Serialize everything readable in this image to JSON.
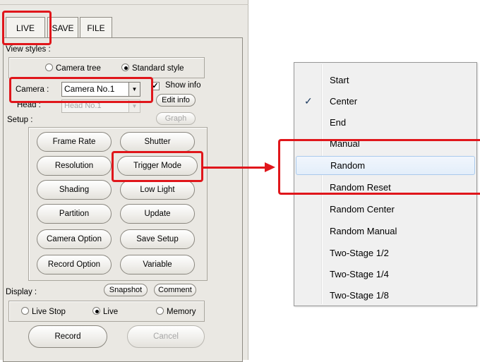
{
  "tabs": [
    {
      "label": "LIVE",
      "active": true
    },
    {
      "label": "SAVE",
      "active": false
    },
    {
      "label": "FILE",
      "active": false
    }
  ],
  "view_styles": {
    "label": "View styles :",
    "options": [
      {
        "label": "Camera tree",
        "selected": false
      },
      {
        "label": "Standard style",
        "selected": true
      }
    ]
  },
  "camera": {
    "label": "Camera :",
    "value": "Camera No.1",
    "show_info_label": "Show info",
    "show_info_checked": true,
    "edit_info_label": "Edit info"
  },
  "head": {
    "label": "Head :",
    "value": "Head No.1",
    "graph_label": "Graph"
  },
  "setup": {
    "label": "Setup :",
    "buttons": [
      "Frame Rate",
      "Shutter",
      "Resolution",
      "Trigger Mode",
      "Shading",
      "Low Light",
      "Partition",
      "Update",
      "Camera Option",
      "Save Setup",
      "Record Option",
      "Variable"
    ]
  },
  "display": {
    "label": "Display :",
    "snapshot_label": "Snapshot",
    "comment_label": "Comment",
    "options": [
      {
        "label": "Live Stop",
        "selected": false
      },
      {
        "label": "Live",
        "selected": true
      },
      {
        "label": "Memory",
        "selected": false
      }
    ]
  },
  "actions": {
    "record_label": "Record",
    "cancel_label": "Cancel"
  },
  "trigger_menu": {
    "items": [
      {
        "label": "Start",
        "checked": false,
        "highlighted": false
      },
      {
        "label": "Center",
        "checked": true,
        "highlighted": false
      },
      {
        "label": "End",
        "checked": false,
        "highlighted": false
      },
      {
        "label": "Manual",
        "checked": false,
        "highlighted": false
      },
      {
        "label": "Random",
        "checked": false,
        "highlighted": true
      },
      {
        "label": "Random Reset",
        "checked": false,
        "highlighted": false
      },
      {
        "label": "Random Center",
        "checked": false,
        "highlighted": false
      },
      {
        "label": "Random Manual",
        "checked": false,
        "highlighted": false
      },
      {
        "label": "Two-Stage 1/2",
        "checked": false,
        "highlighted": false
      },
      {
        "label": "Two-Stage 1/4",
        "checked": false,
        "highlighted": false
      },
      {
        "label": "Two-Stage 1/8",
        "checked": false,
        "highlighted": false
      }
    ],
    "check_glyph": "✓"
  },
  "colors": {
    "annotation_red": "#e0161b",
    "panel_bg": "#eae8e3",
    "menu_bg": "#f0f0f0",
    "menu_highlight_border": "#a9c9ec"
  }
}
